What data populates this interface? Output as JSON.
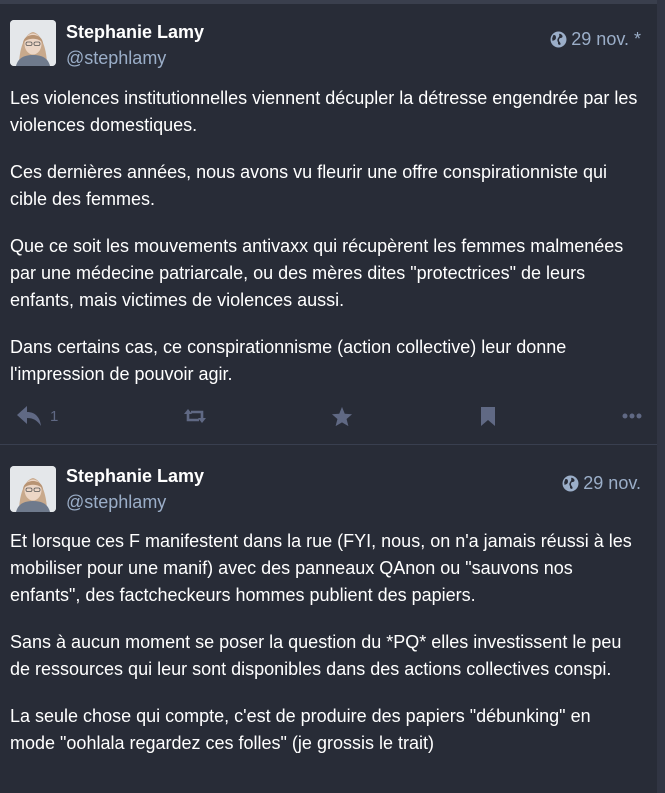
{
  "statuses": [
    {
      "display_name": "Stephanie Lamy",
      "handle": "@stephlamy",
      "date": "29 nov. *",
      "paragraphs": [
        "Les violences institutionnelles viennent décupler la détresse engendrée par les violences domestiques.",
        "Ces dernières années, nous avons vu fleurir une offre conspirationniste qui cible des femmes.",
        "Que ce soit les mouvements antivaxx qui récupèrent les femmes malmenées par une médecine patriarcale, ou des mères dites \"protectrices\" de leurs enfants, mais victimes de violences aussi.",
        "Dans certains cas, ce conspirationnisme (action collective) leur donne l'impression de pouvoir agir."
      ],
      "reply_count": "1",
      "icons": [
        "globe-icon",
        "reply-icon",
        "boost-icon",
        "star-icon",
        "bookmark-icon",
        "ellipsis-icon"
      ]
    },
    {
      "display_name": "Stephanie Lamy",
      "handle": "@stephlamy",
      "date": "29 nov.",
      "paragraphs": [
        "Et lorsque ces F manifestent dans la rue (FYI, nous, on n'a jamais réussi à les mobiliser pour une manif) avec des panneaux QAnon ou \"sauvons nos enfants\", des factcheckeurs hommes publient des papiers.",
        "Sans à aucun moment se poser la question du *PQ* elles investissent le peu de ressources qui leur sont disponibles dans des actions collectives conspi.",
        "La seule chose qui compte, c'est de produire des papiers \"débunking\" en mode \"oohlala regardez ces folles\" (je grossis le trait)"
      ],
      "icons": [
        "globe-icon"
      ]
    }
  ],
  "colors": {
    "background": "#282c37",
    "text": "#ffffff",
    "secondary_text": "#9baec8",
    "action_icons": "#606984"
  }
}
